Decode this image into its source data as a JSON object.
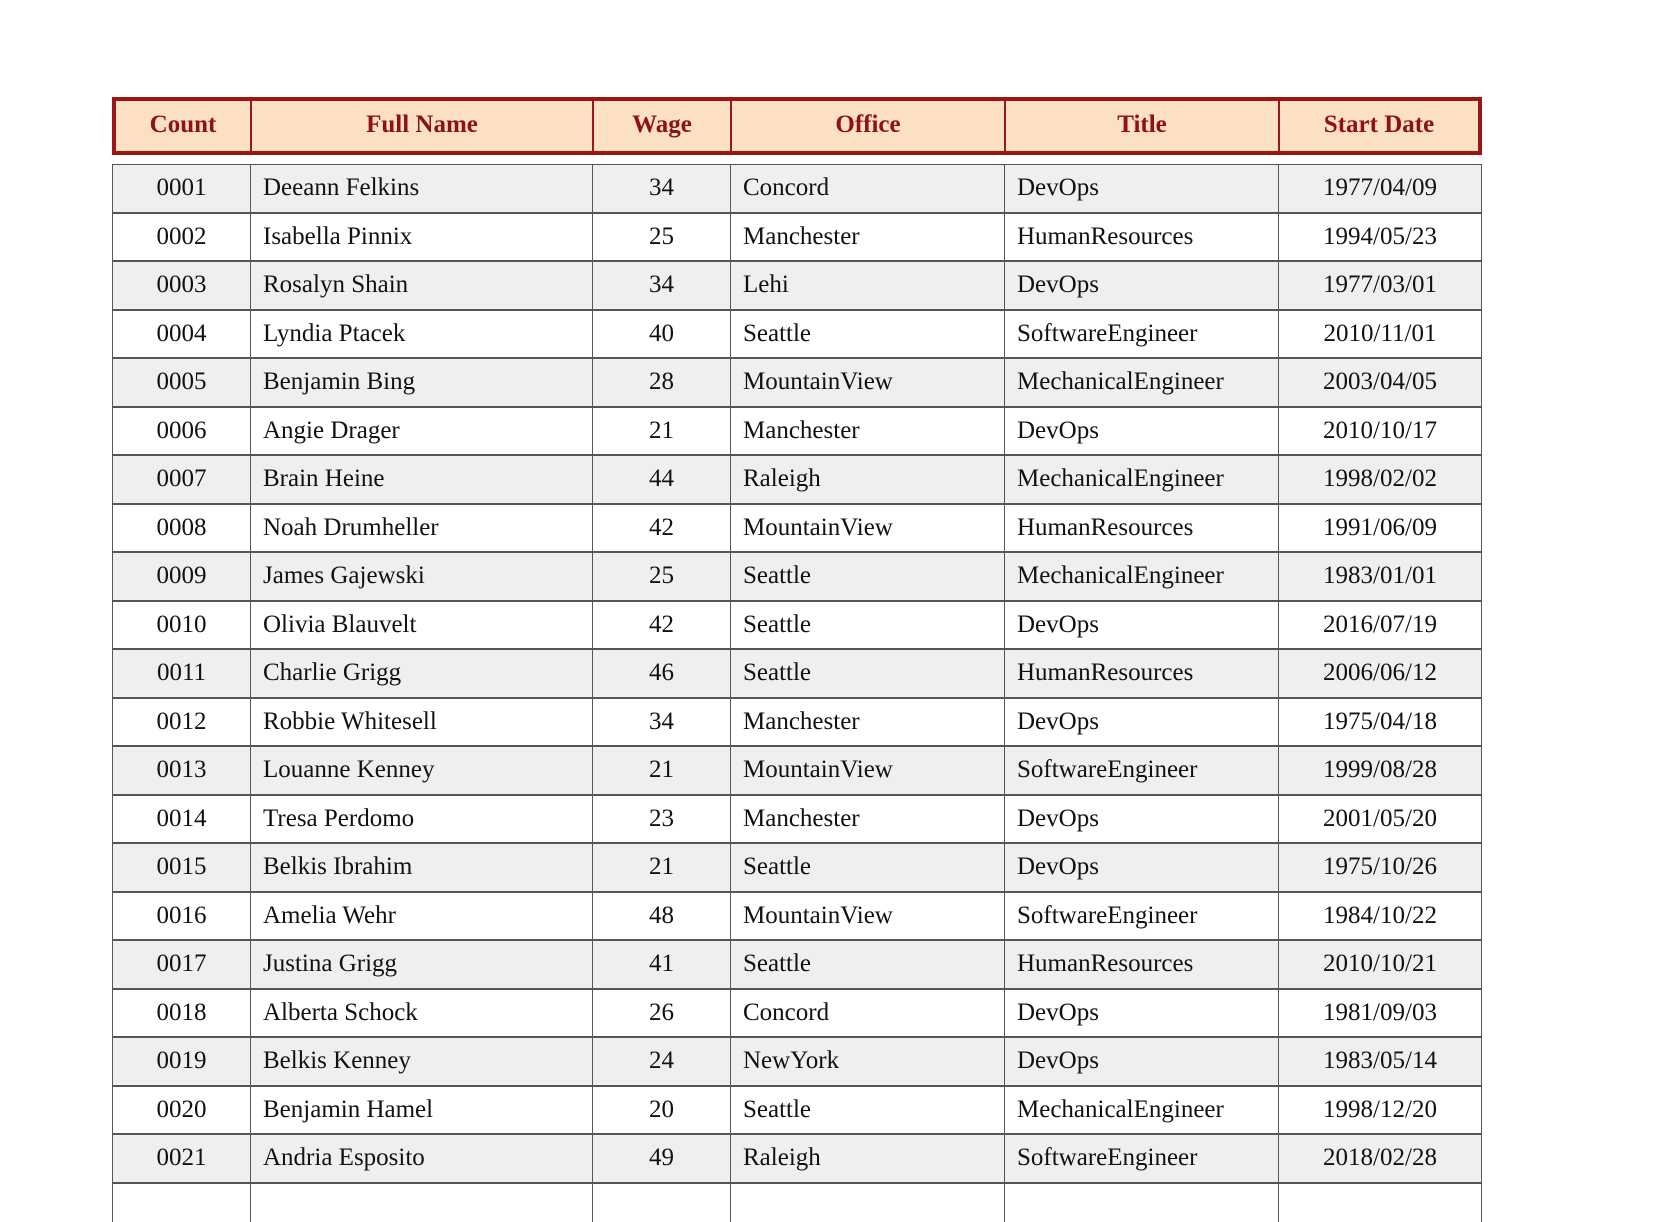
{
  "table": {
    "columns": [
      {
        "key": "count",
        "label": "Count",
        "align": "center"
      },
      {
        "key": "name",
        "label": "Full Name",
        "align": "left"
      },
      {
        "key": "wage",
        "label": "Wage",
        "align": "center"
      },
      {
        "key": "office",
        "label": "Office",
        "align": "left"
      },
      {
        "key": "title",
        "label": "Title",
        "align": "left"
      },
      {
        "key": "date",
        "label": "Start Date",
        "align": "center"
      }
    ],
    "header_text_color": "#8f1212",
    "header_background": "#fbe0c4",
    "header_border_color": "#9d1616",
    "row_alt_background": "#efefef",
    "row_background": "#ffffff",
    "cell_border_color": "#565656",
    "rows": [
      {
        "count": "0001",
        "name": "Deeann Felkins",
        "wage": "34",
        "office": "Concord",
        "title": "DevOps",
        "date": "1977/04/09"
      },
      {
        "count": "0002",
        "name": "Isabella Pinnix",
        "wage": "25",
        "office": "Manchester",
        "title": "HumanResources",
        "date": "1994/05/23"
      },
      {
        "count": "0003",
        "name": "Rosalyn Shain",
        "wage": "34",
        "office": "Lehi",
        "title": "DevOps",
        "date": "1977/03/01"
      },
      {
        "count": "0004",
        "name": "Lyndia Ptacek",
        "wage": "40",
        "office": "Seattle",
        "title": "SoftwareEngineer",
        "date": "2010/11/01"
      },
      {
        "count": "0005",
        "name": "Benjamin Bing",
        "wage": "28",
        "office": "MountainView",
        "title": "MechanicalEngineer",
        "date": "2003/04/05"
      },
      {
        "count": "0006",
        "name": "Angie Drager",
        "wage": "21",
        "office": "Manchester",
        "title": "DevOps",
        "date": "2010/10/17"
      },
      {
        "count": "0007",
        "name": "Brain Heine",
        "wage": "44",
        "office": "Raleigh",
        "title": "MechanicalEngineer",
        "date": "1998/02/02"
      },
      {
        "count": "0008",
        "name": "Noah Drumheller",
        "wage": "42",
        "office": "MountainView",
        "title": "HumanResources",
        "date": "1991/06/09"
      },
      {
        "count": "0009",
        "name": "James Gajewski",
        "wage": "25",
        "office": "Seattle",
        "title": "MechanicalEngineer",
        "date": "1983/01/01"
      },
      {
        "count": "0010",
        "name": "Olivia Blauvelt",
        "wage": "42",
        "office": "Seattle",
        "title": "DevOps",
        "date": "2016/07/19"
      },
      {
        "count": "0011",
        "name": "Charlie Grigg",
        "wage": "46",
        "office": "Seattle",
        "title": "HumanResources",
        "date": "2006/06/12"
      },
      {
        "count": "0012",
        "name": "Robbie Whitesell",
        "wage": "34",
        "office": "Manchester",
        "title": "DevOps",
        "date": "1975/04/18"
      },
      {
        "count": "0013",
        "name": "Louanne Kenney",
        "wage": "21",
        "office": "MountainView",
        "title": "SoftwareEngineer",
        "date": "1999/08/28"
      },
      {
        "count": "0014",
        "name": "Tresa Perdomo",
        "wage": "23",
        "office": "Manchester",
        "title": "DevOps",
        "date": "2001/05/20"
      },
      {
        "count": "0015",
        "name": "Belkis Ibrahim",
        "wage": "21",
        "office": "Seattle",
        "title": "DevOps",
        "date": "1975/10/26"
      },
      {
        "count": "0016",
        "name": "Amelia Wehr",
        "wage": "48",
        "office": "MountainView",
        "title": "SoftwareEngineer",
        "date": "1984/10/22"
      },
      {
        "count": "0017",
        "name": "Justina Grigg",
        "wage": "41",
        "office": "Seattle",
        "title": "HumanResources",
        "date": "2010/10/21"
      },
      {
        "count": "0018",
        "name": "Alberta Schock",
        "wage": "26",
        "office": "Concord",
        "title": "DevOps",
        "date": "1981/09/03"
      },
      {
        "count": "0019",
        "name": "Belkis Kenney",
        "wage": "24",
        "office": "NewYork",
        "title": "DevOps",
        "date": "1983/05/14"
      },
      {
        "count": "0020",
        "name": "Benjamin Hamel",
        "wage": "20",
        "office": "Seattle",
        "title": "MechanicalEngineer",
        "date": "1998/12/20"
      },
      {
        "count": "0021",
        "name": "Andria Esposito",
        "wage": "49",
        "office": "Raleigh",
        "title": "SoftwareEngineer",
        "date": "2018/02/28"
      },
      {
        "count": "",
        "name": "",
        "wage": "",
        "office": "",
        "title": "",
        "date": ""
      }
    ]
  }
}
